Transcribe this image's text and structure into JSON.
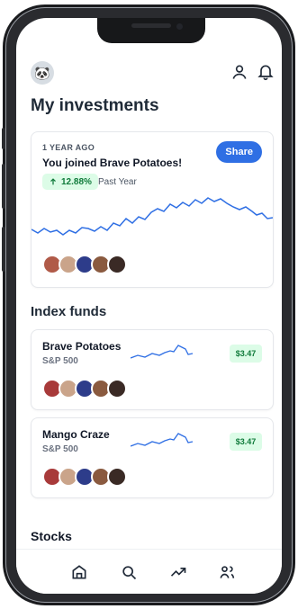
{
  "header": {
    "title": "My investments",
    "avatar_icon": "🐼",
    "icons": [
      "user-icon",
      "bell-icon"
    ]
  },
  "investment_card": {
    "eyebrow": "1 YEAR AGO",
    "title": "You joined Brave Potatoes!",
    "share_label": "Share",
    "change_percent": "12.88%",
    "change_label": "Past Year"
  },
  "section_index_funds": "Index funds",
  "funds": [
    {
      "name": "Brave Potatoes",
      "ticker": "S&P 500",
      "price": "$3.47"
    },
    {
      "name": "Mango Craze",
      "ticker": "S&P 500",
      "price": "$3.47"
    }
  ],
  "section_stocks": "Stocks",
  "bottom_nav": [
    {
      "name": "home",
      "icon": "home-icon"
    },
    {
      "name": "search",
      "icon": "search-icon"
    },
    {
      "name": "trending",
      "icon": "trend-icon"
    },
    {
      "name": "friends",
      "icon": "users-icon"
    }
  ],
  "colors": {
    "accent": "#2f6fe4",
    "positive_bg": "#dcfce7",
    "positive_text": "#0f7a3a",
    "line": "#2f6fe4"
  }
}
